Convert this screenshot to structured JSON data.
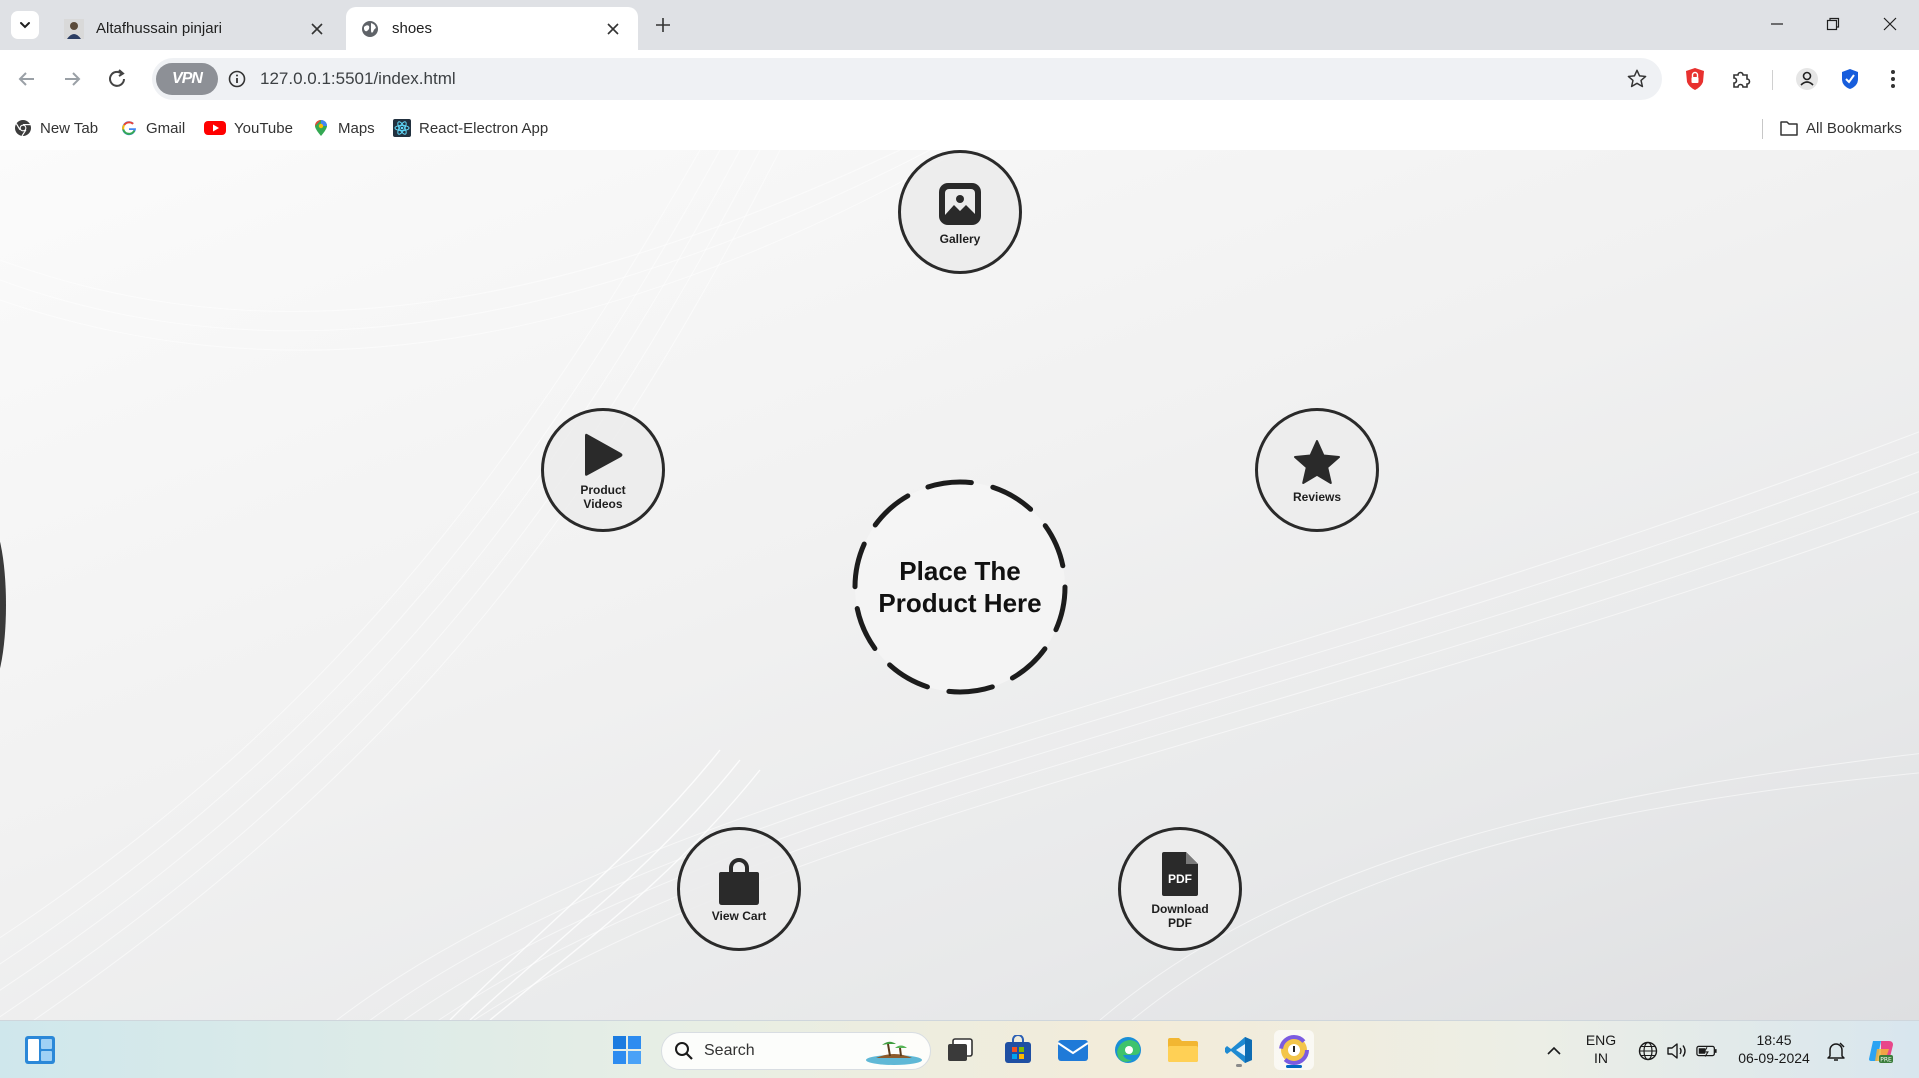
{
  "browser": {
    "tabs": [
      {
        "title": "Altafhussain pinjari",
        "active": false
      },
      {
        "title": "shoes",
        "active": true
      }
    ],
    "address_bar": {
      "vpn_label": "VPN",
      "url": "127.0.0.1:5501/index.html"
    },
    "bookmarks": [
      {
        "label": "New Tab",
        "icon": "chrome-icon"
      },
      {
        "label": "Gmail",
        "icon": "google-icon"
      },
      {
        "label": "YouTube",
        "icon": "youtube-icon"
      },
      {
        "label": "Maps",
        "icon": "maps-icon"
      },
      {
        "label": "React-Electron App",
        "icon": "react-icon"
      }
    ],
    "all_bookmarks_label": "All Bookmarks"
  },
  "page": {
    "center_text": "Place The Product Here",
    "features": [
      {
        "label": "Gallery",
        "icon": "image-icon"
      },
      {
        "label": "Product Videos",
        "icon": "play-icon"
      },
      {
        "label": "Reviews",
        "icon": "star-icon"
      },
      {
        "label": "View Cart",
        "icon": "shopping-bag-icon"
      },
      {
        "label": "Download PDF",
        "icon": "pdf-file-icon",
        "icon_text": "PDF"
      }
    ]
  },
  "taskbar": {
    "search_placeholder": "Search",
    "language": "ENG",
    "region": "IN",
    "time": "18:45",
    "date": "06-09-2024"
  },
  "colors": {
    "feature_border": "#2a2a2a",
    "tab_strip": "#dfe1e5",
    "accent_blue": "#0067c0",
    "brave_red": "#e8312f"
  }
}
